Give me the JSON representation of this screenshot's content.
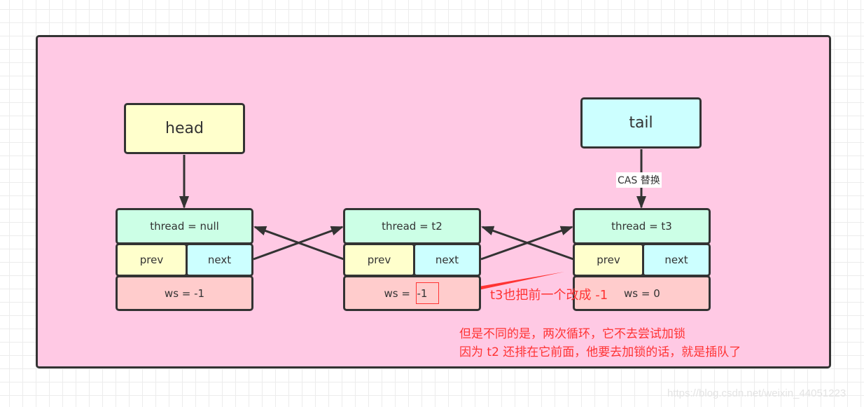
{
  "pointers": {
    "head": "head",
    "tail": "tail",
    "tail_edge_label": "CAS 替换"
  },
  "nodes": [
    {
      "thread": "thread = null",
      "prev": "prev",
      "next": "next",
      "ws": "ws = -1"
    },
    {
      "thread": "thread = t2",
      "prev": "prev",
      "next": "next",
      "ws_prefix": "ws = ",
      "ws_value": "-1"
    },
    {
      "thread": "thread = t3",
      "prev": "prev",
      "next": "next",
      "ws": "ws = 0"
    }
  ],
  "annotations": {
    "arrow_note": "t3也把前一个改成 -1",
    "body_line1": "但是不同的是，两次循环，它不去尝试加锁",
    "body_line2": "因为 t2 还排在它前面，他要去加锁的话，就是插队了"
  },
  "colors": {
    "frame_fill": "#ffc9e4",
    "pointer_yellow": "#ffffcc",
    "pointer_cyan": "#ccffff",
    "thread_mint": "#ccffe6",
    "ws_rose": "#ffcccc",
    "annotation_red": "#ff3333",
    "stroke": "#333333"
  },
  "watermark": "https://blog.csdn.net/weixin_44051223"
}
